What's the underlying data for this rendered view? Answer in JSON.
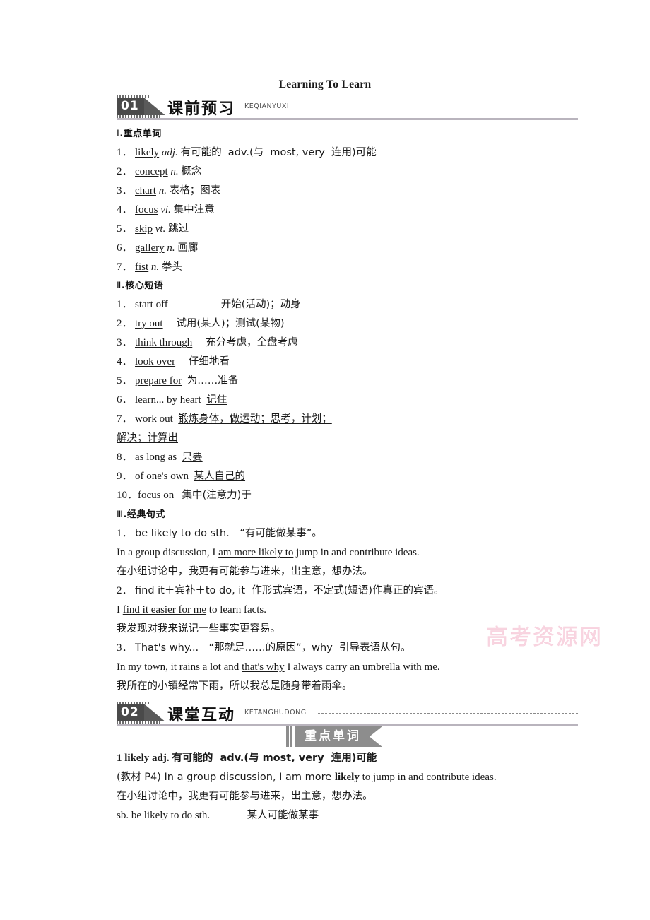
{
  "document": {
    "title": "Learning To Learn",
    "watermark": "高考资源网"
  },
  "sections": [
    {
      "number": "01",
      "cn_title": "课前预习",
      "pinyin": "KEQIANYUXI"
    },
    {
      "number": "02",
      "cn_title": "课堂互动",
      "pinyin": "KETANGHUDONG"
    }
  ],
  "sub_headings": {
    "words": {
      "numeral": "Ⅰ",
      "dot": ".",
      "label": "重点单词"
    },
    "phrases": {
      "numeral": "Ⅱ",
      "dot": ".",
      "label": "核心短语"
    },
    "patterns": {
      "numeral": "Ⅲ",
      "dot": ".",
      "label": "经典句式"
    }
  },
  "key_words": [
    {
      "no": "1．",
      "word": "likely",
      "pos": "adj.",
      "meaning": "有可能的  adv.(与  most, very  连用)可能"
    },
    {
      "no": "2．",
      "word": "concept",
      "pos": "n.",
      "meaning": "概念"
    },
    {
      "no": "3．",
      "word": "chart",
      "pos": "n.",
      "meaning": "表格；图表"
    },
    {
      "no": "4．",
      "word": "focus",
      "pos": "vi.",
      "meaning": "集中注意"
    },
    {
      "no": "5．",
      "word": "skip",
      "pos": "vt.",
      "meaning": "跳过"
    },
    {
      "no": "6．",
      "word": "gallery",
      "pos": "n.",
      "meaning": "画廊"
    },
    {
      "no": "7．",
      "word": "fist",
      "pos": "n.",
      "meaning": "拳头"
    }
  ],
  "key_phrases": [
    {
      "no": "1．",
      "phrase": "start off",
      "gap": "                    ",
      "meaning": "开始(活动)；动身",
      "underline": "phrase"
    },
    {
      "no": "2．",
      "phrase": "try out",
      "gap": "     ",
      "meaning": "试用(某人)；测试(某物)",
      "underline": "phrase"
    },
    {
      "no": "3．",
      "phrase": "think through",
      "gap": "     ",
      "meaning": "充分考虑，全盘考虑",
      "underline": "phrase"
    },
    {
      "no": "4．",
      "phrase": "look over",
      "gap": "     ",
      "meaning": "仔细地看",
      "underline": "phrase"
    },
    {
      "no": "5．",
      "phrase": "prepare for",
      "gap": "  ",
      "meaning": "为……准备",
      "underline": "phrase"
    },
    {
      "no": "6．",
      "phrase": "learn... by heart",
      "gap": "  ",
      "meaning": "记住",
      "underline": "meaning"
    },
    {
      "no": "7．",
      "phrase": "work out",
      "gap": "  ",
      "meaning": "锻炼身体，做运动；思考，计划；",
      "meaning2": "解决；计算出",
      "underline": "meaning"
    },
    {
      "no": "8．",
      "phrase": "as long as",
      "gap": "  ",
      "meaning": "只要",
      "underline": "meaning"
    },
    {
      "no": "9．",
      "phrase": "of one's own",
      "gap": "  ",
      "meaning": "某人自己的",
      "underline": "meaning"
    },
    {
      "no": "10．",
      "phrase": "focus on",
      "gap": "   ",
      "meaning": "集中(注意力)于",
      "underline": "meaning"
    }
  ],
  "sentence_patterns": [
    {
      "no": "1．",
      "head": "be likely to do sth.　“有可能做某事”。",
      "example_pre": "In a group discussion, I ",
      "example_key": "am more likely to",
      "example_post": " jump in and contribute ideas.",
      "translation": "在小组讨论中，我更有可能参与进来，出主意，想办法。"
    },
    {
      "no": "2．",
      "head": "find it＋宾补＋to do, it  作形式宾语，不定式(短语)作真正的宾语。",
      "example_pre": "I ",
      "example_key": "find it easier for me",
      "example_post": " to learn facts.",
      "translation": "我发现对我来说记一些事实更容易。"
    },
    {
      "no": "3．",
      "head": "That's why...　“那就是……的原因”，why  引导表语从句。",
      "example_pre": "In my town, it rains a lot and ",
      "example_key": "that's why",
      "example_post": " I always carry an umbrella with me.",
      "translation": "我所在的小镇经常下雨，所以我总是随身带着雨伞。"
    }
  ],
  "ribbon": {
    "label": "重点单词"
  },
  "word_entry": {
    "headword_no": "1",
    "headword": "likely",
    "pos": "adj.",
    "definition": "有可能的  adv.(与 most, very  连用)可能",
    "source_pre": "(教材 P4) In a group discussion, I am more ",
    "source_key": "likely",
    "source_post": " to jump in and contribute ideas.",
    "translation": "在小组讨论中，我更有可能参与进来，出主意，想办法。",
    "usage_en": "sb. be likely to do sth.",
    "usage_gap": "              ",
    "usage_cn": "某人可能做某事"
  }
}
